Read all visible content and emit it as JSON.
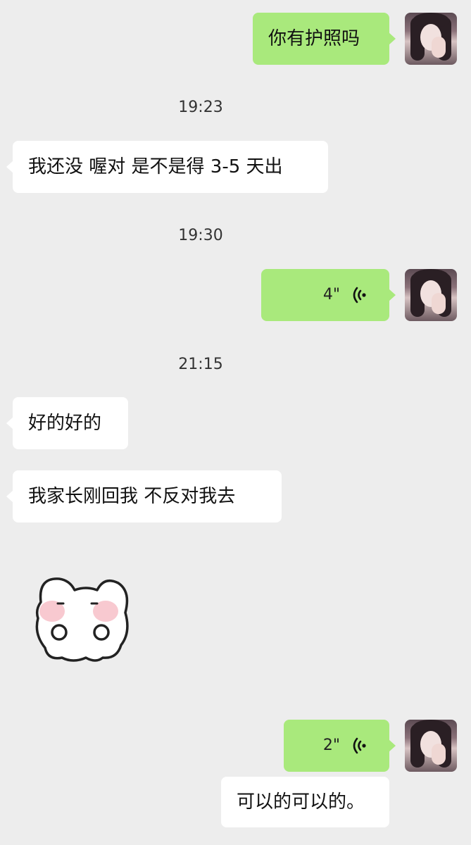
{
  "messages": [
    {
      "text": "你有护照吗"
    },
    {
      "time": "19:23"
    },
    {
      "text": "我还没 喔对 是不是得 3-5 天出"
    },
    {
      "time": "19:30"
    },
    {
      "voice_duration": "4\""
    },
    {
      "time": "21:15"
    },
    {
      "text": "好的好的"
    },
    {
      "text": "我家长刚回我 不反对我去"
    },
    {
      "voice_duration": "2\""
    },
    {
      "text": "可以的可以的。"
    }
  ],
  "colors": {
    "background": "#ededed",
    "my_bubble": "#a9e97c",
    "other_bubble": "#ffffff",
    "sticker_cheek": "#f8c9d0"
  },
  "icons": {
    "voice": "voice-wave-icon",
    "sticker": "bunny-sticker"
  }
}
